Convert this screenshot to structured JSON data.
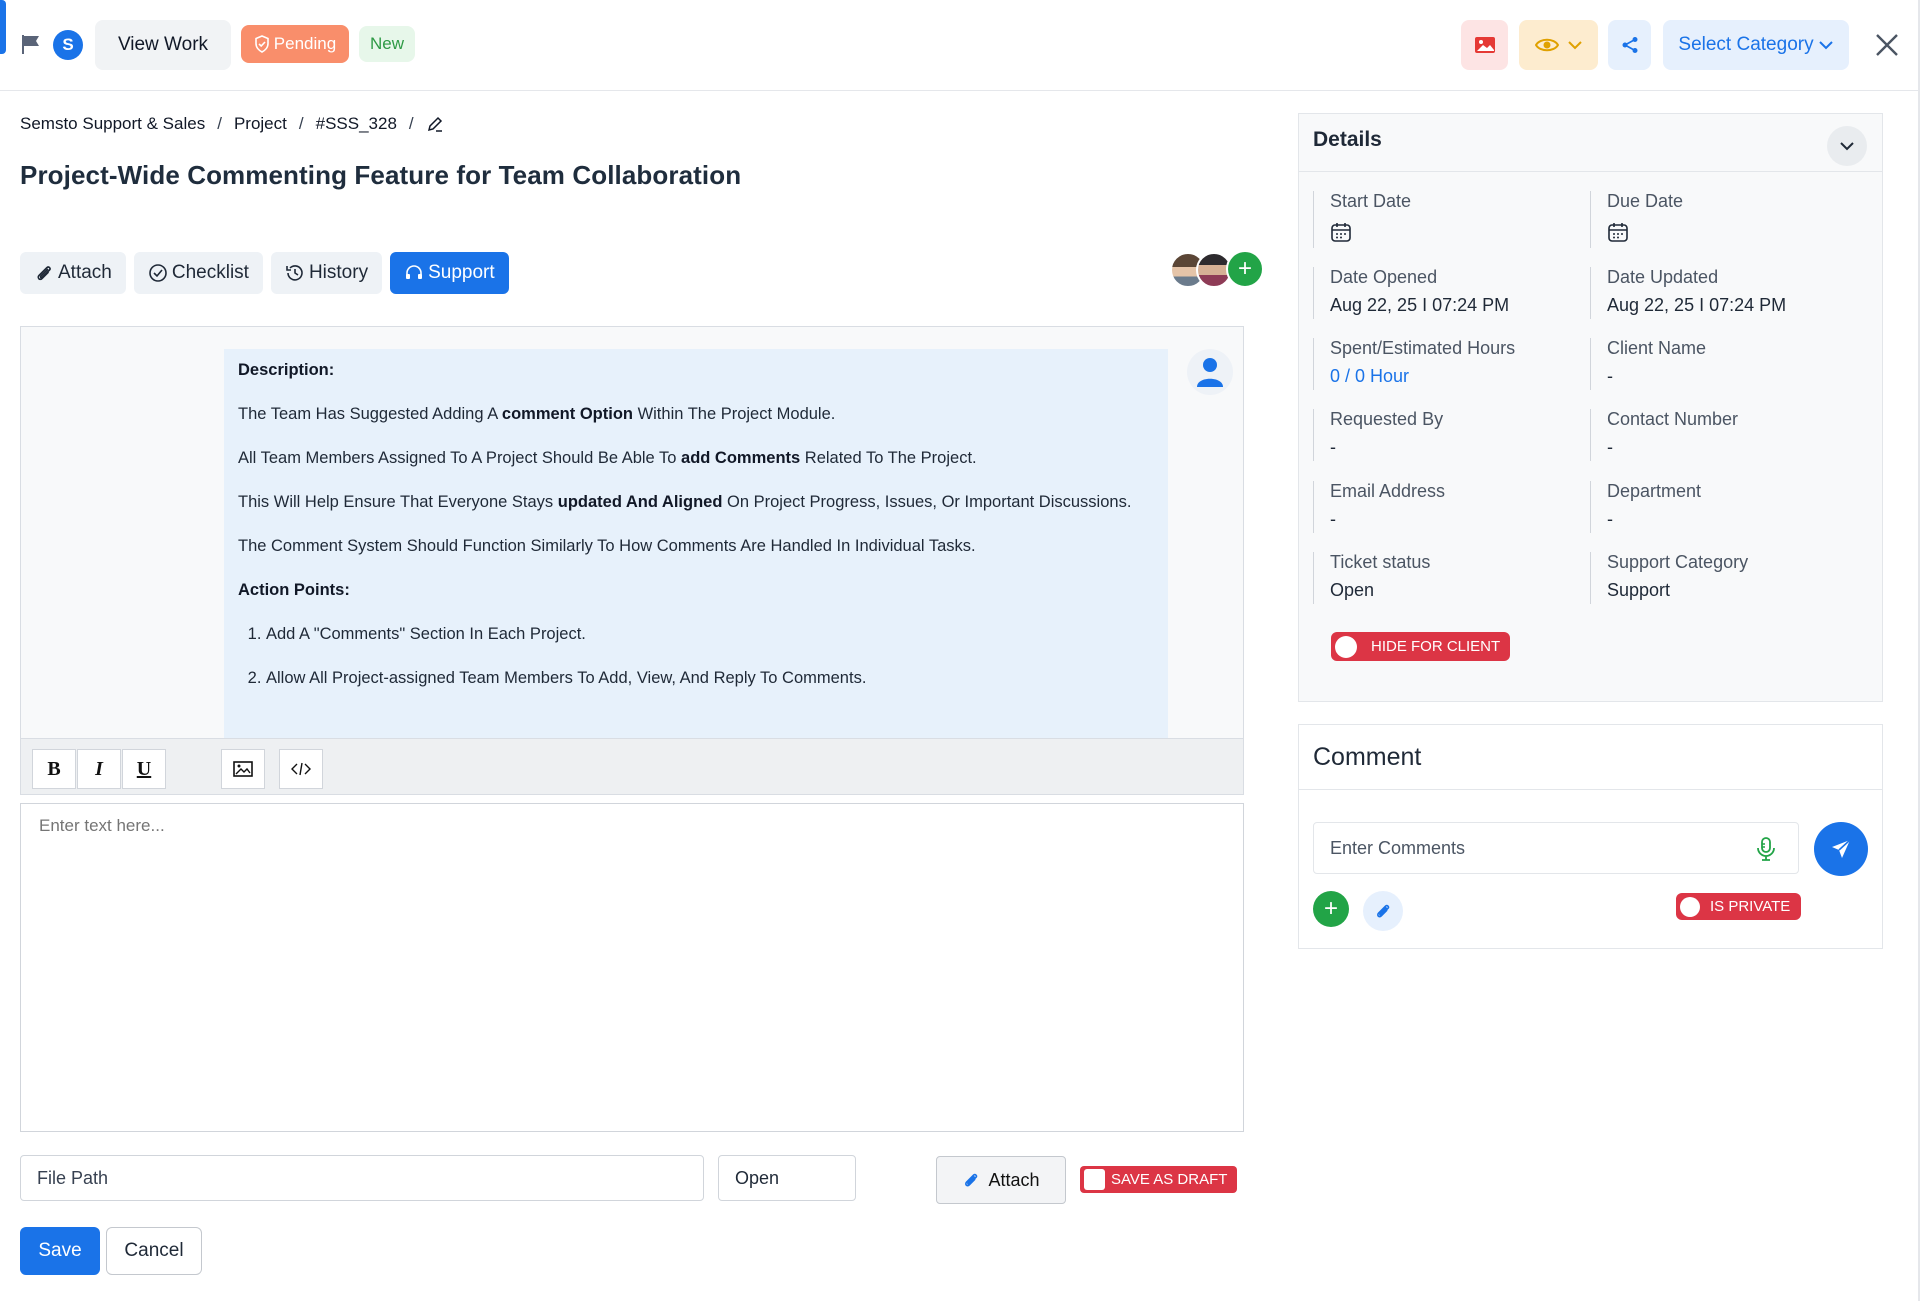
{
  "topbar": {
    "avatar_letter": "S",
    "view_work": "View Work",
    "status_badge": "Pending",
    "new_badge": "New",
    "category_select": "Select Category",
    "colors": {
      "primary": "#1a73e8",
      "pending": "#f98e6b",
      "danger": "#dc3545",
      "success": "#22a447"
    }
  },
  "breadcrumb": [
    "Semsto Support & Sales",
    "Project",
    "#SSS_328"
  ],
  "page_title": "Project-Wide Commenting Feature for Team Collaboration",
  "tabs": [
    {
      "label": "Attach",
      "icon": "paperclip-icon"
    },
    {
      "label": "Checklist",
      "icon": "check-circle-icon"
    },
    {
      "label": "History",
      "icon": "history-icon"
    },
    {
      "label": "Support",
      "icon": "headset-icon",
      "active": true
    }
  ],
  "description": {
    "heading": "Description:",
    "p1_pre": "The Team Has Suggested Adding A ",
    "p1_bold": "comment Option",
    "p1_post": " Within The Project Module.",
    "p2_pre": "All Team Members Assigned To A Project Should Be Able To ",
    "p2_bold": "add Comments",
    "p2_post": " Related To The Project.",
    "p3_pre": "This Will Help Ensure That Everyone Stays ",
    "p3_bold": "updated And Aligned",
    "p3_post": " On Project Progress, Issues, Or Important Discussions.",
    "p4": "The Comment System Should Function Similarly To How Comments Are Handled In Individual Tasks.",
    "action_heading": "Action Points:",
    "action_points": [
      "Add A \"Comments\" Section In Each Project.",
      "Allow All Project-assigned Team Members To Add, View, And Reply To Comments."
    ]
  },
  "editor": {
    "bold": "B",
    "italic": "I",
    "underline": "U",
    "placeholder": "Enter text here..."
  },
  "footer": {
    "file_path": "File Path",
    "open": "Open",
    "attach": "Attach",
    "save_draft": "SAVE AS DRAFT",
    "save": "Save",
    "cancel": "Cancel"
  },
  "details": {
    "title": "Details",
    "fields": {
      "start_date": {
        "label": "Start Date"
      },
      "due_date": {
        "label": "Due Date"
      },
      "date_opened": {
        "label": "Date Opened",
        "value": "Aug 22, 25 I 07:24 PM"
      },
      "date_updated": {
        "label": "Date Updated",
        "value": "Aug 22, 25 I 07:24 PM"
      },
      "hours": {
        "label": "Spent/Estimated Hours",
        "value": "0 / 0 Hour"
      },
      "client_name": {
        "label": "Client Name",
        "value": "-"
      },
      "requested_by": {
        "label": "Requested By",
        "value": "-"
      },
      "contact_number": {
        "label": "Contact Number",
        "value": "-"
      },
      "email": {
        "label": "Email Address",
        "value": "-"
      },
      "department": {
        "label": "Department",
        "value": "-"
      },
      "ticket_status": {
        "label": "Ticket status",
        "value": "Open"
      },
      "support_category": {
        "label": "Support Category",
        "value": "Support"
      }
    },
    "hide_for_client": "HIDE FOR CLIENT"
  },
  "comment": {
    "title": "Comment",
    "placeholder": "Enter Comments",
    "is_private": "IS PRIVATE"
  }
}
